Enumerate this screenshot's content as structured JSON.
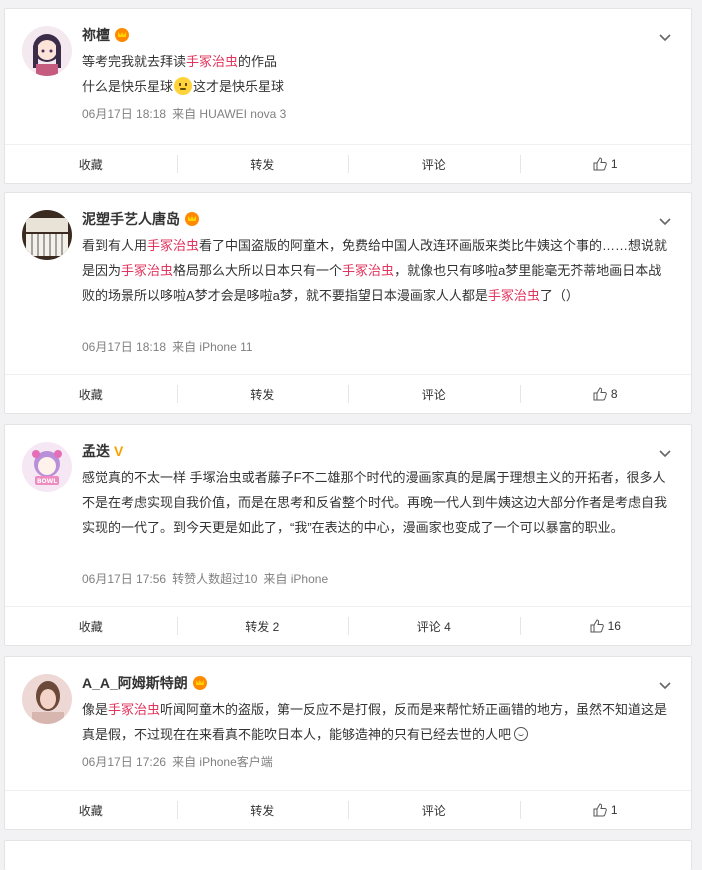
{
  "posts": [
    {
      "username": "祢檀",
      "badge": "vip",
      "content_parts": [
        "等考完我就去拜读",
        "手冢治虫",
        "的作品"
      ],
      "content_line2": [
        "什么是快乐星球",
        "这才是快乐星球"
      ],
      "meta": [
        "06月17日 18:18",
        "来自 HUAWEI nova 3"
      ],
      "actions": {
        "collect": "收藏",
        "repost": "转发",
        "comment": "评论",
        "like": "1"
      }
    },
    {
      "username": "泥塑手艺人唐岛",
      "badge": "vip",
      "content": [
        {
          "t": "看到有人用"
        },
        {
          "t": "手冢治虫",
          "hl": true
        },
        {
          "t": "看了中国盗版的阿童木，免费给中国人改连环画版来类比牛姨这个事的……想说就是因为"
        },
        {
          "t": "手冢治虫",
          "hl": true
        },
        {
          "t": "格局那么大所以日本只有一个"
        },
        {
          "t": "手冢治虫",
          "hl": true
        },
        {
          "t": "，就像也只有哆啦a梦里能毫无芥蒂地画日本战败的场景所以哆啦A梦才会是哆啦a梦，就不要指望日本漫画家人人都是"
        },
        {
          "t": "手冢治虫",
          "hl": true
        },
        {
          "t": "了（）"
        }
      ],
      "meta": [
        "06月17日 18:18",
        "来自 iPhone 11"
      ],
      "actions": {
        "collect": "收藏",
        "repost": "转发",
        "comment": "评论",
        "like": "8"
      }
    },
    {
      "username": "孟迭",
      "badge": "V",
      "content": [
        {
          "t": "感觉真的不太一样 手塚治虫或者藤子F不二雄那个时代的漫画家真的是属于理想主义的开拓者，很多人不是在考虑实现自我价值，而是在思考和反省整个时代。再晚一代人到牛姨这边大部分作者是考虑自我实现的一代了。到今天更是如此了，“我”在表达的中心，漫画家也变成了一个可以暴富的职业。"
        }
      ],
      "meta": [
        "06月17日 17:56",
        "转赞人数超过10",
        "来自 iPhone"
      ],
      "actions": {
        "collect": "收藏",
        "repost": "转发 2",
        "comment": "评论 4",
        "like": "16"
      }
    },
    {
      "username": "A_A_阿姆斯特朗",
      "badge": "vip",
      "content": [
        {
          "t": "像是"
        },
        {
          "t": "手冢治虫",
          "hl": true
        },
        {
          "t": "听闻阿童木的盗版，第一反应不是打假，反而是来帮忙矫正画错的地方，虽然不知道这是真是假，不过现在在来看真不能吹日本人，能够造神的只有已经去世的人吧"
        }
      ],
      "meta": [
        "06月17日 17:26",
        "来自 iPhone客户端"
      ],
      "actions": {
        "collect": "收藏",
        "repost": "转发",
        "comment": "评论",
        "like": "1"
      }
    }
  ]
}
